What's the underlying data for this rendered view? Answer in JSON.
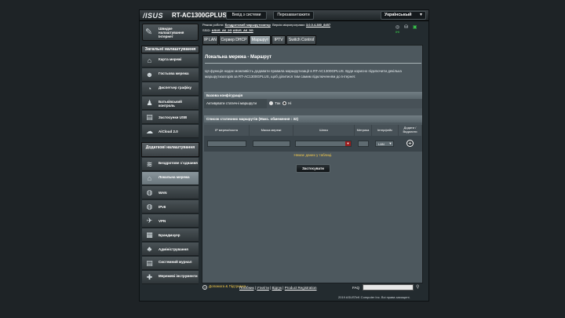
{
  "header": {
    "brand": "/ISUS",
    "model": "RT-AC1300GPLUS",
    "logout_label": "Вихід з системи",
    "reboot_label": "Перезавантажити",
    "language": "Українськый"
  },
  "info": {
    "mode_label": "Режим роботи:",
    "mode_value": "Бездротовий маршрутизатор",
    "firmware_label": "Версія мікропрограми:",
    "firmware_value": "3.0.0.4.380_8457",
    "ssid_label": "SSID:",
    "ssid_1": "ASUS_A6_2G",
    "ssid_2": "ASUS_A6_5G"
  },
  "sidebar": {
    "qis_label": "Швидке налаштування Інтернет",
    "general_header": "Загальні налаштування",
    "general_items": [
      {
        "label": "Карта мережі",
        "icon": "network-map-icon"
      },
      {
        "label": "Гостьова мережа",
        "icon": "guest-network-icon"
      },
      {
        "label": "Диспетчер графіку",
        "icon": "traffic-manager-icon"
      },
      {
        "label": "Батьківський контроль",
        "icon": "parental-control-icon"
      },
      {
        "label": "Застосунки USB",
        "icon": "usb-icon"
      },
      {
        "label": "AiCloud 2.0",
        "icon": "cloud-icon"
      }
    ],
    "advanced_header": "Додаткові налаштування",
    "advanced_items": [
      {
        "label": "Бездротове з`єднання",
        "icon": "wireless-icon"
      },
      {
        "label": "Локальна мережа",
        "icon": "lan-icon"
      },
      {
        "label": "WAN",
        "icon": "wan-globe-icon"
      },
      {
        "label": "IPv6",
        "icon": "ipv6-icon"
      },
      {
        "label": "VPN",
        "icon": "vpn-icon"
      },
      {
        "label": "Брандмауер",
        "icon": "firewall-icon"
      },
      {
        "label": "Адміністрування",
        "icon": "administration-icon"
      },
      {
        "label": "Системний журнал",
        "icon": "system-log-icon"
      },
      {
        "label": "Мережеві інструменти",
        "icon": "network-tools-icon"
      }
    ]
  },
  "tabs": [
    "IP LAN",
    "Сервер DHCP",
    "Маршрут",
    "IPTV",
    "Switch Control"
  ],
  "page": {
    "title": "Локальна мережа - Маршрут",
    "description": "Ця функція надає можливість додавати правила маршрутизації в RT-AC1300GPLUS. Буде корисно підключити декілька маршрутизаторів за RT-AC1300GPLUS, щоб ділитися тим самим підключенням до Інтернет.",
    "basic_config_header": "Базова конфігурація",
    "static_routes_label": "Активувати статичні маршрути",
    "option_yes": "Так",
    "option_no": "Ні",
    "selected_option": "Ні",
    "routes_header": "Список статичних маршрутів (Макс. обмеження : 32)",
    "columns": [
      "IP мережі/хоста",
      "Маска мережі",
      "Шлюз",
      "Метрика",
      "Інтерфейс",
      "Додати / Видалити"
    ],
    "interface_value": "LAN",
    "no_data": "Немає даних у таблиці.",
    "apply_label": "Застосувати"
  },
  "footer": {
    "help_label": "Допомога & Підтримка",
    "links": [
      "Посібник",
      "Утиліти",
      "Відгук",
      "Product Registration"
    ],
    "faq_label": "FAQ",
    "copyright": "2019 ASUSTeK Computer Inc. Всі права захищені."
  }
}
